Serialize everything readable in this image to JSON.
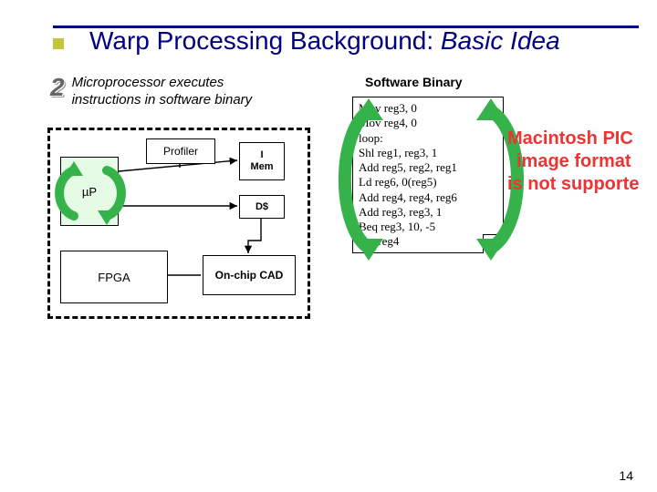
{
  "title": {
    "prefix": "Warp Processing Background:",
    "italic": "Basic Idea"
  },
  "step": {
    "number": "2",
    "text": "Microprocessor executes instructions in software binary"
  },
  "diagram": {
    "up_label": "µP",
    "profiler_label": "Profiler",
    "imem_line1": "I",
    "imem_line2": "Mem",
    "dcache_label": "D$",
    "fpga_label": "FPGA",
    "oncad_label": "On-chip CAD"
  },
  "software_binary": {
    "title": "Software Binary",
    "code_lines": [
      "Mov reg3, 0",
      "Mov reg4, 0",
      "loop:",
      "Shl reg1, reg3, 1",
      "Add reg5, reg2, reg1",
      "Ld reg6, 0(reg5)",
      "Add reg4, reg4, reg6",
      "Add reg3, reg3, 1",
      "Beq reg3, 10, -5",
      "Ret reg4"
    ]
  },
  "error_text": {
    "line1": "Macintosh PIC",
    "line2": "image format",
    "line3": "is not supporte"
  },
  "page_number": "14"
}
